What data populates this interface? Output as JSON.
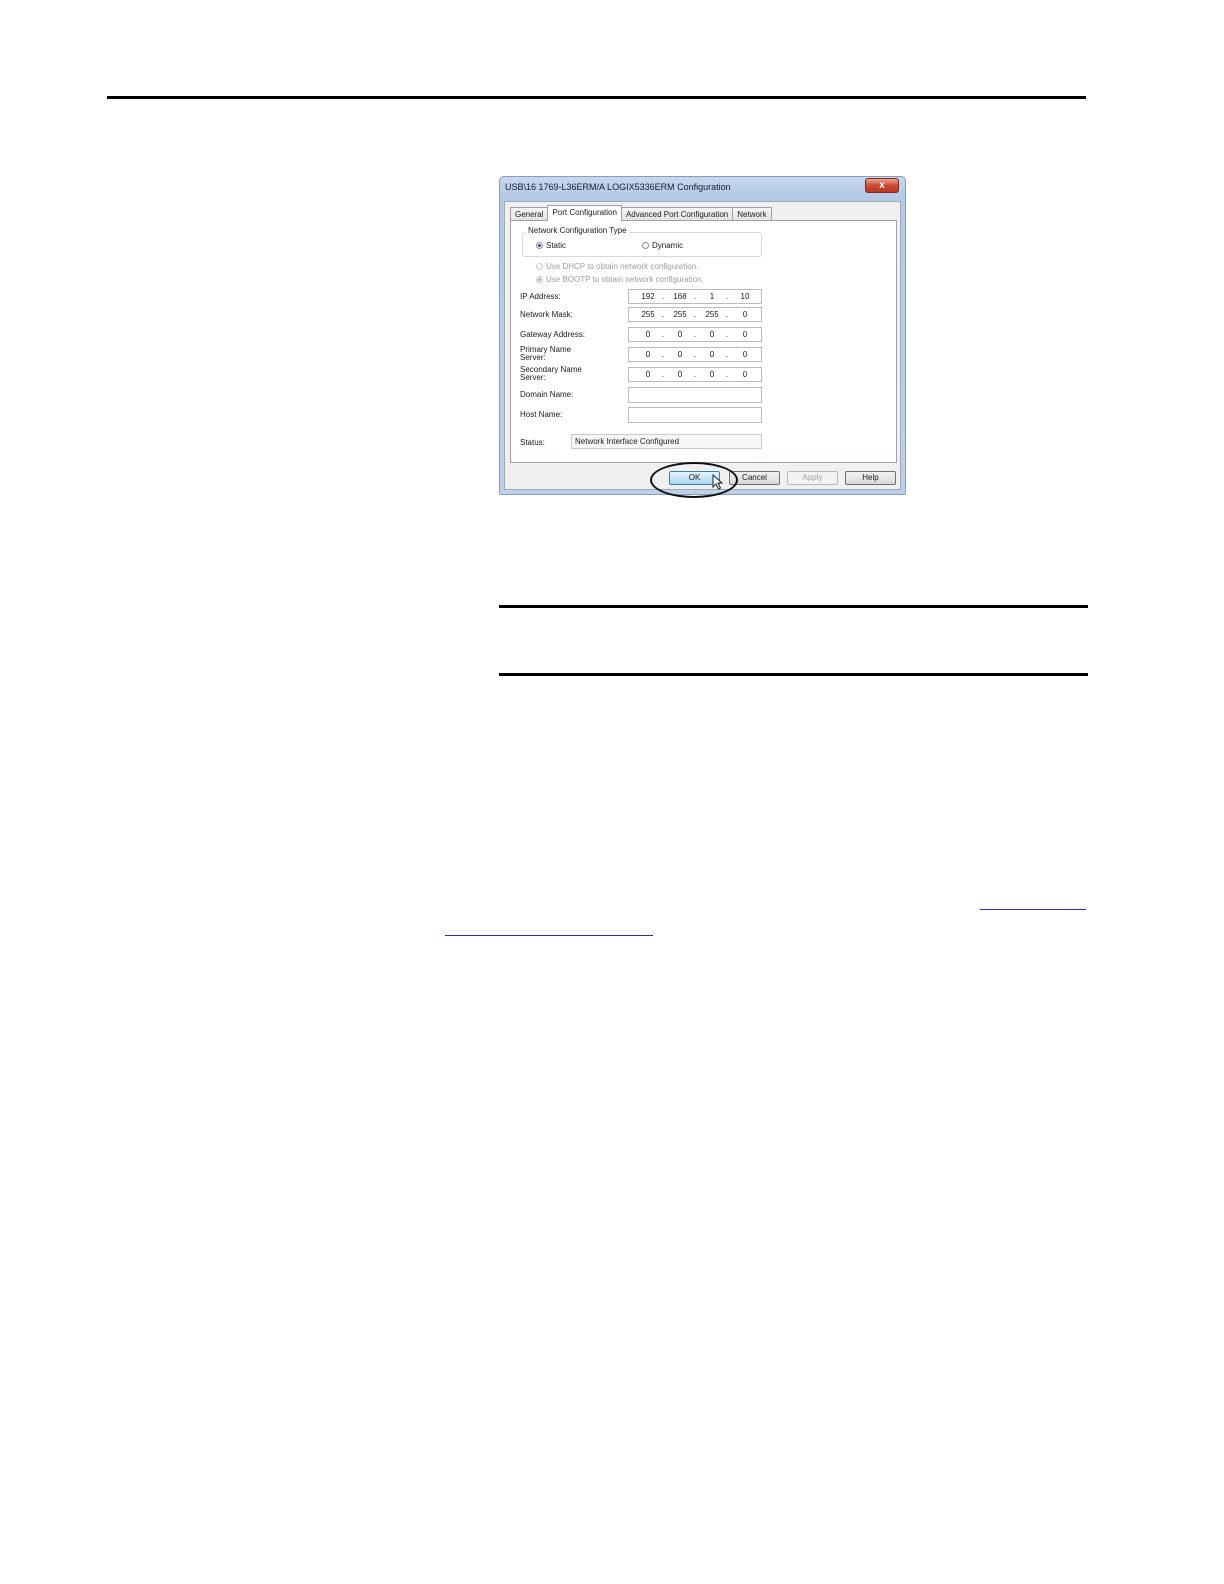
{
  "dialog": {
    "title": "USB\\16 1769-L36ERM/A LOGIX5336ERM Configuration",
    "close_label": "x",
    "tabs": [
      {
        "label": "General"
      },
      {
        "label": "Port Configuration"
      },
      {
        "label": "Advanced Port Configuration"
      },
      {
        "label": "Network"
      }
    ],
    "active_tab": "Port Configuration",
    "network_config": {
      "legend": "Network Configuration Type",
      "static_label": "Static",
      "dynamic_label": "Dynamic",
      "selected": "Static"
    },
    "dhcp_label": "Use DHCP to obtain network configuration.",
    "bootp_label": "Use BOOTP to obtain network configuration.",
    "fields": {
      "ip_address": {
        "label": "IP Address:",
        "octets": [
          "192",
          "168",
          "1",
          "10"
        ]
      },
      "network_mask": {
        "label": "Network Mask:",
        "octets": [
          "255",
          "255",
          "255",
          "0"
        ]
      },
      "gateway_address": {
        "label": "Gateway Address:",
        "octets": [
          "0",
          "0",
          "0",
          "0"
        ]
      },
      "primary_name_server": {
        "label_line1": "Primary Name",
        "label_line2": "Server:",
        "octets": [
          "0",
          "0",
          "0",
          "0"
        ]
      },
      "secondary_name_server": {
        "label_line1": "Secondary Name",
        "label_line2": "Server:",
        "octets": [
          "0",
          "0",
          "0",
          "0"
        ]
      },
      "domain_name": {
        "label": "Domain Name:",
        "value": ""
      },
      "host_name": {
        "label": "Host Name:",
        "value": ""
      }
    },
    "status": {
      "label": "Status:",
      "value": "Network Interface Configured"
    },
    "buttons": {
      "ok": "OK",
      "cancel": "Cancel",
      "apply": "Apply",
      "help": "Help"
    }
  },
  "icons": {
    "close": "close-icon",
    "cursor": "mouse-pointer-icon",
    "highlight": "callout-ellipse"
  },
  "colors": {
    "titlebar": "#b3c9e6",
    "close_button": "#cc4a36",
    "default_button": "#c4e5f6",
    "link": "#2a2ac8"
  }
}
